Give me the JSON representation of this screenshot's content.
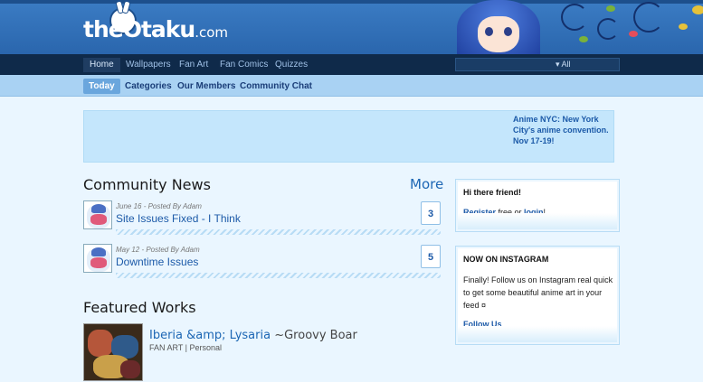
{
  "site": {
    "logo_name": "theOtaku",
    "logo_domain": ".com"
  },
  "nav": {
    "items": [
      "Home",
      "Wallpapers",
      "Fan Art",
      "Fan Comics",
      "Quizzes"
    ],
    "search_scope": "All"
  },
  "subnav": {
    "items": [
      "Today",
      "Categories",
      "Our Members",
      "Community Chat"
    ]
  },
  "banner": {
    "text": "Anime NYC: New York City's anime convention. Nov 17-19!"
  },
  "news": {
    "heading": "Community News",
    "more_label": "More",
    "posts": [
      {
        "meta": "June 16 - Posted By Adam",
        "title": "Site Issues Fixed - I Think",
        "comments": "3"
      },
      {
        "meta": "May 12 - Posted By Adam",
        "title": "Downtime Issues",
        "comments": "5"
      }
    ]
  },
  "featured": {
    "heading": "Featured Works",
    "work": {
      "title": "Iberia &amp; Lysaria",
      "author": "~Groovy Boar",
      "category": "FAN ART | Personal"
    }
  },
  "welcome": {
    "greeting": "Hi there friend!",
    "register": "Register",
    "free_or": " free or ",
    "login": "login",
    "end": "!"
  },
  "instagram": {
    "heading": "NOW ON INSTAGRAM",
    "text": "Finally! Follow us on Instagram real quick to get some beautiful anime art in your feed ¤",
    "link": "Follow Us"
  },
  "colors": {
    "header": "#2a66ad",
    "navbar": "#0f2a4a",
    "subnav": "#a9d2f3",
    "link": "#1c5aa8"
  }
}
